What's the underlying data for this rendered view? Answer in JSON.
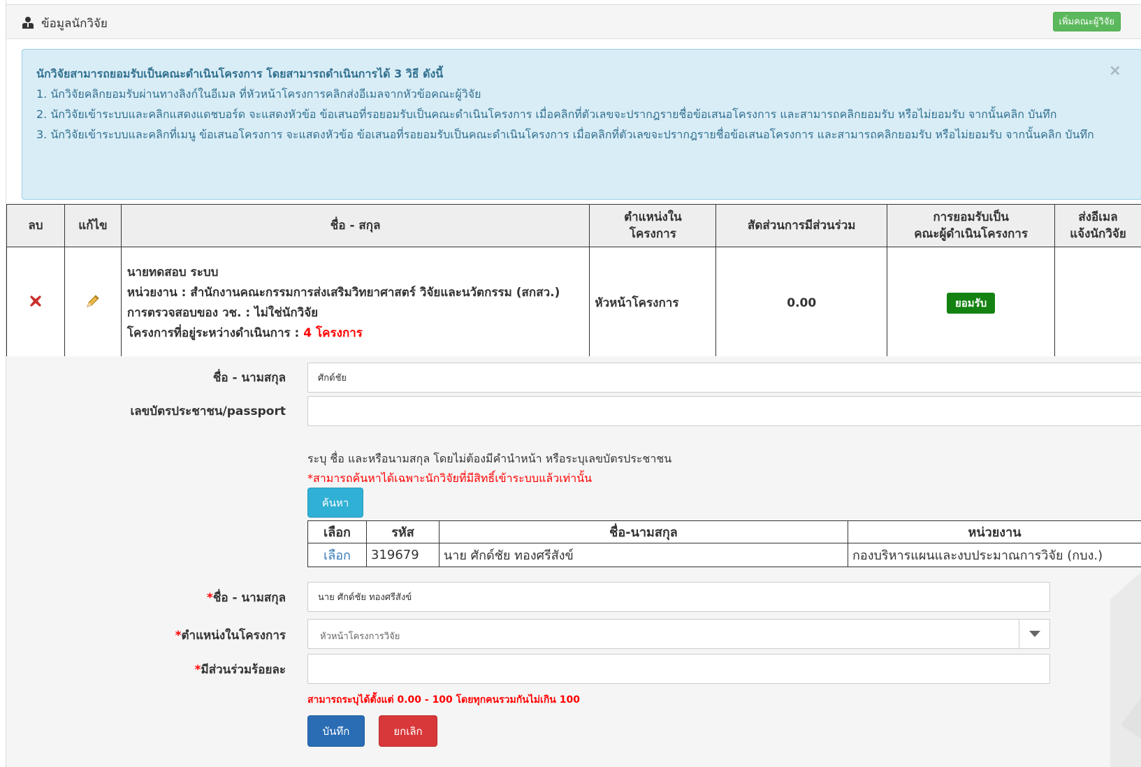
{
  "header": {
    "title": "ข้อมูลนักวิจัย",
    "add_team_label": "เพิ่มคณะผู้วิจัย"
  },
  "alert": {
    "title": "นักวิจัยสามารถยอมรับเป็นคณะดำเนินโครงการ โดยสามารถดำเนินการได้ 3 วิธี ดังนี้",
    "line1": "1. นักวิจัยคลิกยอมรับผ่านทางลิงก์ในอีเมล ที่หัวหน้าโครงการคลิกส่งอีเมลจากหัวข้อคณะผู้วิจัย",
    "line2": "2. นักวิจัยเข้าระบบและคลิกแสดงแดชบอร์ด จะแสดงหัวข้อ ข้อเสนอที่รอยอมรับเป็นคณะดำเนินโครงการ เมื่อคลิกที่ตัวเลขจะปรากฎรายชื่อข้อเสนอโครงการ และสามารถคลิกยอมรับ หรือไม่ยอมรับ จากนั้นคลิก บันทึก",
    "line3": "3. นักวิจัยเข้าระบบและคลิกที่เมนู ข้อเสนอโครงการ จะแสดงหัวข้อ ข้อเสนอที่รอยอมรับเป็นคณะดำเนินโครงการ เมื่อคลิกที่ตัวเลขจะปรากฎรายชื่อข้อเสนอโครงการ และสามารถคลิกยอมรับ หรือไม่ยอมรับ จากนั้นคลิก บันทึก",
    "close_symbol": "×"
  },
  "team_table": {
    "headers": {
      "delete": "ลบ",
      "edit": "แก้ไข",
      "name": "ชื่อ - สกุล",
      "role_line1": "ตำแหน่งใน",
      "role_line2": "โครงการ",
      "ratio": "สัดส่วนการมีส่วนร่วม",
      "accept_line1": "การยอมรับเป็น",
      "accept_line2": "คณะผู้ดำเนินโครงการ",
      "email_line1": "ส่งอีเมล",
      "email_line2": "แจ้งนักวิจัย"
    },
    "rows": [
      {
        "name": "นายทดสอบ ระบบ",
        "agency_label": "หน่วยงาน : ",
        "agency": "สำนักงานคณะกรรมการส่งเสริมวิทยาศาสตร์ วิจัยและนวัตกรรม (สกสว.)",
        "check_label": "การตรวจสอบของ วช. : ",
        "check_value": "ไม่ใช่นักวิจัย",
        "ongoing_label": "โครงการที่อยู่ระหว่างดำเนินการ : ",
        "ongoing_value": "4 โครงการ",
        "role": "หัวหน้าโครงการ",
        "ratio": "0.00",
        "accept_status": "ยอมรับ"
      }
    ]
  },
  "search_form": {
    "name_label": "ชื่อ - นามสกุล",
    "name_value": "ศักด์ชัย",
    "id_label": "เลขบัตรประชาชน/passport",
    "id_value": "",
    "help_text": "ระบุ ชื่อ และหรือนามสกุล โดยไม่ต้องมีคำนำหน้า หรือระบุเลขบัตรประชาชน",
    "help_red": "*สามารถค้นหาได้เฉพาะนักวิจัยที่มีสิทธิ์เข้าระบบแล้วเท่านั้น",
    "search_button": "ค้นหา"
  },
  "result_table": {
    "headers": {
      "select": "เลือก",
      "code": "รหัส",
      "name": "ชื่อ-นามสกุล",
      "agency": "หน่วยงาน"
    },
    "rows": [
      {
        "select": "เลือก",
        "code": "319679",
        "name": "นาย ศักด์ชัย ทองศรีสังข์",
        "agency": "กองบริหารแผนและงบประมาณการวิจัย (กบง.)"
      }
    ]
  },
  "member_form": {
    "required_mark": "*",
    "fullname_label": "ชื่อ - นามสกุล",
    "fullname_value": "นาย ศักด์ชัย ทองศรีสังข์",
    "role_label": "ตำแหน่งในโครงการ",
    "role_value": "หัวหน้าโครงการวิจัย",
    "percent_label": "มีส่วนร่วมร้อยละ",
    "percent_value": "",
    "percent_help": "สามารถระบุได้ตั้งแต่ 0.00 - 100 โดยทุกคนรวมกันไม่เกิน 100",
    "save_button": "บันทึก",
    "cancel_button": "ยกเลิก"
  },
  "colors": {
    "accept_badge": "#138212",
    "alert_bg": "#d9edf7",
    "alert_text": "#31708f",
    "danger": "#d9383a",
    "primary": "#2a6db5",
    "info": "#31b0d5",
    "success": "#5cb85c"
  },
  "icons": {
    "header": "user-icon",
    "delete": "delete-x-icon",
    "edit": "pencil-icon",
    "dropdown": "chevron-down-icon"
  }
}
